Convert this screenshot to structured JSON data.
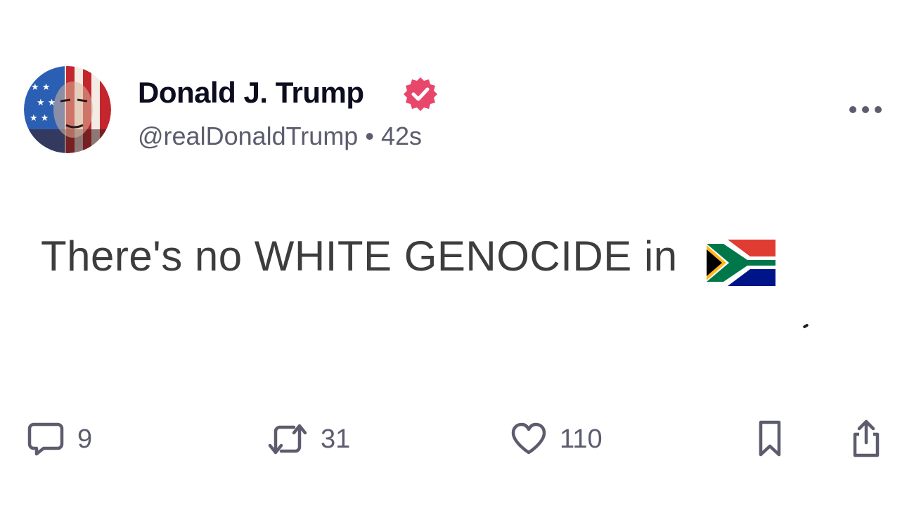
{
  "post": {
    "author": {
      "display_name": "Donald J. Trump",
      "handle": "@realDonaldTrump",
      "separator": "•",
      "timestamp": "42s",
      "verified": true
    },
    "text": "There's no WHITE GENOCIDE in",
    "emoji": "south-africa-flag",
    "actions": {
      "replies": "9",
      "reposts": "31",
      "likes": "110"
    }
  },
  "colors": {
    "verified_badge": "#e8466a",
    "muted_text": "#5c5c6e",
    "name_text": "#0d0d20",
    "body_text": "#3d3d3d"
  },
  "icons": [
    "more-horizontal-icon",
    "verified-badge-icon",
    "reply-icon",
    "repost-icon",
    "heart-icon",
    "bookmark-icon",
    "share-icon"
  ]
}
